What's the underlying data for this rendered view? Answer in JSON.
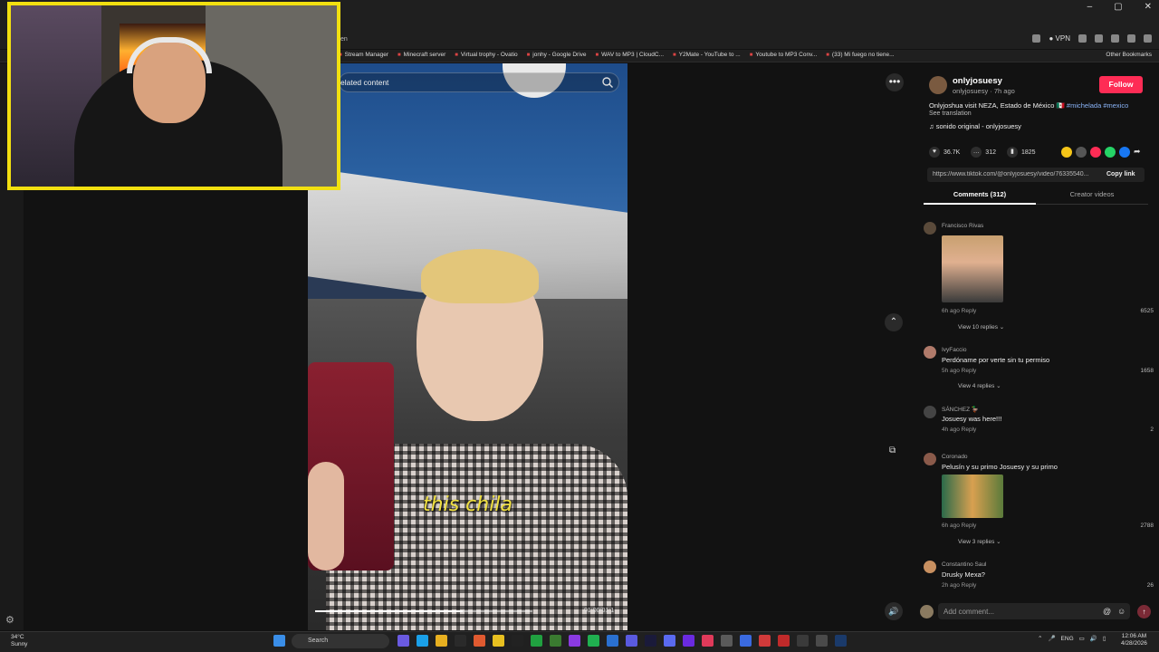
{
  "browser": {
    "window_controls": [
      "–",
      "▢",
      "✕"
    ],
    "address_fragment": "en",
    "vpn_label": "VPN",
    "bookmarks": [
      "Stream Manager",
      "Minecraft server",
      "Virtual trophy - Ovatio",
      "jonhy - Google Drive",
      "WAV to MP3 | CloudC...",
      "Y2Mate - YouTube to ...",
      "Youtube to MP3 Conv...",
      "(33) Mi fuego no tiene..."
    ],
    "other_bookmarks": "Other Bookmarks"
  },
  "video": {
    "search_placeholder": "elated content",
    "caption": "this chila",
    "timecode": "01:00/01:1",
    "progress": 0.68
  },
  "post": {
    "author": "onlyjosuesy",
    "author_sub": "onlyjosuesy · 7h ago",
    "follow_label": "Follow",
    "desc_text": "Onlyjoshua visit NEZA, Estado de México 🇲🇽 ",
    "desc_tags": "#michelada #mexico",
    "see_translation": "See translation",
    "sound": "♫  sonido original - onlyjosuesy",
    "likes": "36.7K",
    "comments_count": "312",
    "saves": "1825",
    "url": "https://www.tiktok.com/@onlyjosuesy/video/76335540...",
    "copy_link": "Copy link",
    "tab_comments": "Comments (312)",
    "tab_creator": "Creator videos",
    "share_colors": [
      "#f5c518",
      "#555555",
      "#fe2c55",
      "#25d366",
      "#1877f2"
    ]
  },
  "comments": [
    {
      "name": "Francisco Rivas",
      "text": "",
      "meta": "6h ago   Reply",
      "likes": "6525",
      "view": "View 10 replies ⌄"
    },
    {
      "name": "IvyFaccio",
      "text": "Perdóname por verte sin tu permiso",
      "meta": "5h ago   Reply",
      "likes": "1658",
      "view": "View 4 replies ⌄"
    },
    {
      "name": "SÁNCHEZ 🦆",
      "text": "Josuesy was here!!!",
      "meta": "4h ago   Reply",
      "likes": "2",
      "view": ""
    },
    {
      "name": "Coronado",
      "text": "Pelusín y su primo Josuesy y su primo",
      "meta": "6h ago   Reply",
      "likes": "2788",
      "view": "View 3 replies ⌄"
    },
    {
      "name": "Constantino Saul",
      "text": "Drusky Mexa?",
      "meta": "2h ago   Reply",
      "likes": "26",
      "view": ""
    }
  ],
  "composer": {
    "placeholder": "Add comment...",
    "at": "@",
    "emoji": "☺",
    "post": "↑"
  },
  "taskbar": {
    "temp": "34°C",
    "weather": "Sunny",
    "search": "Search",
    "lang": "ENG",
    "time": "12:06 AM",
    "date": "4/28/2026"
  }
}
